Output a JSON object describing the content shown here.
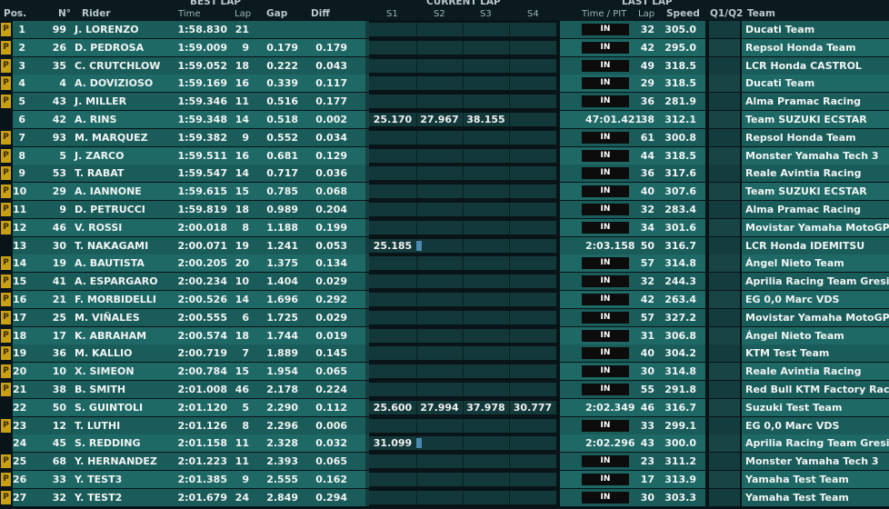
{
  "header": {
    "pos": "Pos.",
    "num": "N°",
    "rider": "Rider",
    "best_lap": "BEST LAP",
    "time": "Time",
    "lap": "Lap",
    "gap": "Gap",
    "diff": "Diff",
    "current_lap": "CURRENT LAP",
    "s1": "S1",
    "s2": "S2",
    "s3": "S3",
    "s4": "S4",
    "last_lap": "LAST LAP",
    "time_pit": "Time / PIT",
    "last_lap_col": "Lap",
    "speed": "Speed",
    "q": "Q1/Q2",
    "team": "Team"
  },
  "colors": {
    "main_odd": "#1a5c5a",
    "main_even": "#1e6966",
    "dim_odd": "#143c3e",
    "dim_even": "#184446",
    "pit_box": "#c8a012",
    "in_box": "#0c0c0c"
  },
  "rows": [
    {
      "pos": "1",
      "pit": "P",
      "num": "99",
      "rider": "J. LORENZO",
      "time": "1:58.830",
      "lap": "21",
      "gap": "",
      "diff": "",
      "cur": [],
      "prog": false,
      "last": "IN",
      "last_in": true,
      "lap2": "32",
      "speed": "305.0",
      "team": "Ducati Team"
    },
    {
      "pos": "2",
      "pit": "P",
      "num": "26",
      "rider": "D. PEDROSA",
      "time": "1:59.009",
      "lap": "9",
      "gap": "0.179",
      "diff": "0.179",
      "cur": [],
      "prog": false,
      "last": "IN",
      "last_in": true,
      "lap2": "42",
      "speed": "295.0",
      "team": "Repsol Honda Team"
    },
    {
      "pos": "3",
      "pit": "P",
      "num": "35",
      "rider": "C. CRUTCHLOW",
      "time": "1:59.052",
      "lap": "18",
      "gap": "0.222",
      "diff": "0.043",
      "cur": [],
      "prog": false,
      "last": "IN",
      "last_in": true,
      "lap2": "49",
      "speed": "318.5",
      "team": "LCR Honda CASTROL"
    },
    {
      "pos": "4",
      "pit": "P",
      "num": "4",
      "rider": "A. DOVIZIOSO",
      "time": "1:59.169",
      "lap": "16",
      "gap": "0.339",
      "diff": "0.117",
      "cur": [],
      "prog": false,
      "last": "IN",
      "last_in": true,
      "lap2": "29",
      "speed": "318.5",
      "team": "Ducati Team"
    },
    {
      "pos": "5",
      "pit": "P",
      "num": "43",
      "rider": "J. MILLER",
      "time": "1:59.346",
      "lap": "11",
      "gap": "0.516",
      "diff": "0.177",
      "cur": [],
      "prog": false,
      "last": "IN",
      "last_in": true,
      "lap2": "36",
      "speed": "281.9",
      "team": "Alma Pramac Racing"
    },
    {
      "pos": "6",
      "pit": "",
      "num": "42",
      "rider": "A. RINS",
      "time": "1:59.348",
      "lap": "14",
      "gap": "0.518",
      "diff": "0.002",
      "cur": [
        "25.170",
        "27.967",
        "38.155"
      ],
      "prog": false,
      "last": "47:01.421",
      "last_in": false,
      "lap2": "38",
      "speed": "312.1",
      "team": "Team SUZUKI ECSTAR"
    },
    {
      "pos": "7",
      "pit": "P",
      "num": "93",
      "rider": "M. MARQUEZ",
      "time": "1:59.382",
      "lap": "9",
      "gap": "0.552",
      "diff": "0.034",
      "cur": [],
      "prog": false,
      "last": "IN",
      "last_in": true,
      "lap2": "61",
      "speed": "300.8",
      "team": "Repsol Honda Team"
    },
    {
      "pos": "8",
      "pit": "P",
      "num": "5",
      "rider": "J. ZARCO",
      "time": "1:59.511",
      "lap": "16",
      "gap": "0.681",
      "diff": "0.129",
      "cur": [],
      "prog": false,
      "last": "IN",
      "last_in": true,
      "lap2": "44",
      "speed": "318.5",
      "team": "Monster Yamaha Tech 3"
    },
    {
      "pos": "9",
      "pit": "P",
      "num": "53",
      "rider": "T. RABAT",
      "time": "1:59.547",
      "lap": "14",
      "gap": "0.717",
      "diff": "0.036",
      "cur": [],
      "prog": false,
      "last": "IN",
      "last_in": true,
      "lap2": "36",
      "speed": "317.6",
      "team": "Reale Avintia Racing"
    },
    {
      "pos": "10",
      "pit": "P",
      "num": "29",
      "rider": "A. IANNONE",
      "time": "1:59.615",
      "lap": "15",
      "gap": "0.785",
      "diff": "0.068",
      "cur": [],
      "prog": false,
      "last": "IN",
      "last_in": true,
      "lap2": "40",
      "speed": "307.6",
      "team": "Team SUZUKI ECSTAR"
    },
    {
      "pos": "11",
      "pit": "P",
      "num": "9",
      "rider": "D. PETRUCCI",
      "time": "1:59.819",
      "lap": "18",
      "gap": "0.989",
      "diff": "0.204",
      "cur": [],
      "prog": false,
      "last": "IN",
      "last_in": true,
      "lap2": "32",
      "speed": "283.4",
      "team": "Alma Pramac Racing"
    },
    {
      "pos": "12",
      "pit": "P",
      "num": "46",
      "rider": "V. ROSSI",
      "time": "2:00.018",
      "lap": "8",
      "gap": "1.188",
      "diff": "0.199",
      "cur": [],
      "prog": false,
      "last": "IN",
      "last_in": true,
      "lap2": "34",
      "speed": "301.6",
      "team": "Movistar Yamaha MotoGP"
    },
    {
      "pos": "13",
      "pit": "",
      "num": "30",
      "rider": "T. NAKAGAMI",
      "time": "2:00.071",
      "lap": "19",
      "gap": "1.241",
      "diff": "0.053",
      "cur": [
        "25.185"
      ],
      "prog": true,
      "last": "2:03.158",
      "last_in": false,
      "lap2": "50",
      "speed": "316.7",
      "team": "LCR Honda IDEMITSU"
    },
    {
      "pos": "14",
      "pit": "P",
      "num": "19",
      "rider": "A. BAUTISTA",
      "time": "2:00.205",
      "lap": "20",
      "gap": "1.375",
      "diff": "0.134",
      "cur": [],
      "prog": false,
      "last": "IN",
      "last_in": true,
      "lap2": "57",
      "speed": "314.8",
      "team": "Ángel Nieto Team"
    },
    {
      "pos": "15",
      "pit": "P",
      "num": "41",
      "rider": "A. ESPARGARO",
      "time": "2:00.234",
      "lap": "10",
      "gap": "1.404",
      "diff": "0.029",
      "cur": [],
      "prog": false,
      "last": "IN",
      "last_in": true,
      "lap2": "32",
      "speed": "244.3",
      "team": "Aprilia Racing Team Gresini"
    },
    {
      "pos": "16",
      "pit": "P",
      "num": "21",
      "rider": "F. MORBIDELLI",
      "time": "2:00.526",
      "lap": "14",
      "gap": "1.696",
      "diff": "0.292",
      "cur": [],
      "prog": false,
      "last": "IN",
      "last_in": true,
      "lap2": "42",
      "speed": "263.4",
      "team": "EG 0,0 Marc VDS"
    },
    {
      "pos": "17",
      "pit": "P",
      "num": "25",
      "rider": "M. VIÑALES",
      "time": "2:00.555",
      "lap": "6",
      "gap": "1.725",
      "diff": "0.029",
      "cur": [],
      "prog": false,
      "last": "IN",
      "last_in": true,
      "lap2": "57",
      "speed": "327.2",
      "team": "Movistar Yamaha MotoGP"
    },
    {
      "pos": "18",
      "pit": "P",
      "num": "17",
      "rider": "K. ABRAHAM",
      "time": "2:00.574",
      "lap": "18",
      "gap": "1.744",
      "diff": "0.019",
      "cur": [],
      "prog": false,
      "last": "IN",
      "last_in": true,
      "lap2": "31",
      "speed": "306.8",
      "team": "Ángel Nieto Team"
    },
    {
      "pos": "19",
      "pit": "P",
      "num": "36",
      "rider": "M. KALLIO",
      "time": "2:00.719",
      "lap": "7",
      "gap": "1.889",
      "diff": "0.145",
      "cur": [],
      "prog": false,
      "last": "IN",
      "last_in": true,
      "lap2": "40",
      "speed": "304.2",
      "team": "KTM Test Team"
    },
    {
      "pos": "20",
      "pit": "P",
      "num": "10",
      "rider": "X. SIMEON",
      "time": "2:00.784",
      "lap": "15",
      "gap": "1.954",
      "diff": "0.065",
      "cur": [],
      "prog": false,
      "last": "IN",
      "last_in": true,
      "lap2": "30",
      "speed": "314.8",
      "team": "Reale Avintia Racing"
    },
    {
      "pos": "21",
      "pit": "P",
      "num": "38",
      "rider": "B. SMITH",
      "time": "2:01.008",
      "lap": "46",
      "gap": "2.178",
      "diff": "0.224",
      "cur": [],
      "prog": false,
      "last": "IN",
      "last_in": true,
      "lap2": "55",
      "speed": "291.8",
      "team": "Red Bull KTM Factory Racin"
    },
    {
      "pos": "22",
      "pit": "",
      "num": "50",
      "rider": "S. GUINTOLI",
      "time": "2:01.120",
      "lap": "5",
      "gap": "2.290",
      "diff": "0.112",
      "cur": [
        "25.600",
        "27.994",
        "37.978",
        "30.777"
      ],
      "prog": false,
      "last": "2:02.349",
      "last_in": false,
      "lap2": "46",
      "speed": "316.7",
      "team": "Suzuki Test Team"
    },
    {
      "pos": "23",
      "pit": "P",
      "num": "12",
      "rider": "T. LUTHI",
      "time": "2:01.126",
      "lap": "8",
      "gap": "2.296",
      "diff": "0.006",
      "cur": [],
      "prog": false,
      "last": "IN",
      "last_in": true,
      "lap2": "33",
      "speed": "299.1",
      "team": "EG 0,0 Marc VDS"
    },
    {
      "pos": "24",
      "pit": "",
      "num": "45",
      "rider": "S. REDDING",
      "time": "2:01.158",
      "lap": "11",
      "gap": "2.328",
      "diff": "0.032",
      "cur": [
        "31.099"
      ],
      "prog": true,
      "last": "2:02.296",
      "last_in": false,
      "lap2": "43",
      "speed": "300.0",
      "team": "Aprilia Racing Team Gresini"
    },
    {
      "pos": "25",
      "pit": "P",
      "num": "68",
      "rider": "Y. HERNANDEZ",
      "time": "2:01.223",
      "lap": "11",
      "gap": "2.393",
      "diff": "0.065",
      "cur": [],
      "prog": false,
      "last": "IN",
      "last_in": true,
      "lap2": "23",
      "speed": "311.2",
      "team": "Monster Yamaha Tech 3"
    },
    {
      "pos": "26",
      "pit": "P",
      "num": "33",
      "rider": "Y. TEST3",
      "time": "2:01.385",
      "lap": "9",
      "gap": "2.555",
      "diff": "0.162",
      "cur": [],
      "prog": false,
      "last": "IN",
      "last_in": true,
      "lap2": "17",
      "speed": "313.9",
      "team": "Yamaha Test Team"
    },
    {
      "pos": "27",
      "pit": "P",
      "num": "32",
      "rider": "Y. TEST2",
      "time": "2:01.679",
      "lap": "24",
      "gap": "2.849",
      "diff": "0.294",
      "cur": [],
      "prog": false,
      "last": "IN",
      "last_in": true,
      "lap2": "30",
      "speed": "303.3",
      "team": "Yamaha Test Team"
    }
  ]
}
